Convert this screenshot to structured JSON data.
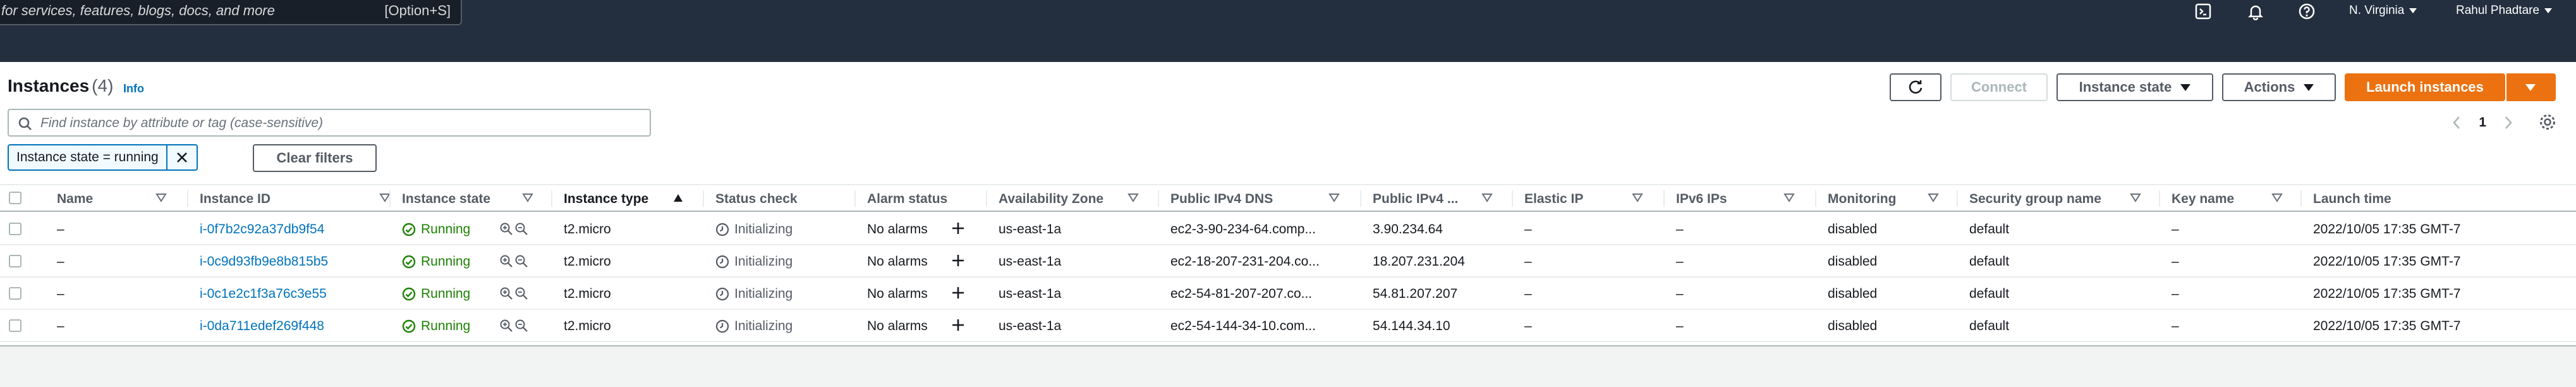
{
  "nav": {
    "search_placeholder": "for services, features, blogs, docs, and more",
    "search_shortcut": "[Option+S]",
    "region": "N. Virginia",
    "user": "Rahul Phadtare"
  },
  "header": {
    "title": "Instances",
    "count": "(4)",
    "info": "Info",
    "connect": "Connect",
    "instance_state": "Instance state",
    "actions": "Actions",
    "launch": "Launch instances"
  },
  "filter": {
    "placeholder": "Find instance by attribute or tag (case-sensitive)",
    "token": "Instance state = running",
    "clear": "Clear filters"
  },
  "pagination": {
    "page": "1"
  },
  "columns": [
    "Name",
    "Instance ID",
    "Instance state",
    "Instance type",
    "Status check",
    "Alarm status",
    "Availability Zone",
    "Public IPv4 DNS",
    "Public IPv4 ...",
    "Elastic IP",
    "IPv6 IPs",
    "Monitoring",
    "Security group name",
    "Key name",
    "Launch time"
  ],
  "rows": [
    {
      "name": "–",
      "id": "i-0f7b2c92a37db9f54",
      "state": "Running",
      "type": "t2.micro",
      "status": "Initializing",
      "alarm": "No alarms",
      "az": "us-east-1a",
      "dns": "ec2-3-90-234-64.comp...",
      "ipv4": "3.90.234.64",
      "eip": "–",
      "ipv6": "–",
      "monitoring": "disabled",
      "sg": "default",
      "key": "–",
      "launch": "2022/10/05 17:35 GMT-7"
    },
    {
      "name": "–",
      "id": "i-0c9d93fb9e8b815b5",
      "state": "Running",
      "type": "t2.micro",
      "status": "Initializing",
      "alarm": "No alarms",
      "az": "us-east-1a",
      "dns": "ec2-18-207-231-204.co...",
      "ipv4": "18.207.231.204",
      "eip": "–",
      "ipv6": "–",
      "monitoring": "disabled",
      "sg": "default",
      "key": "–",
      "launch": "2022/10/05 17:35 GMT-7"
    },
    {
      "name": "–",
      "id": "i-0c1e2c1f3a76c3e55",
      "state": "Running",
      "type": "t2.micro",
      "status": "Initializing",
      "alarm": "No alarms",
      "az": "us-east-1a",
      "dns": "ec2-54-81-207-207.co...",
      "ipv4": "54.81.207.207",
      "eip": "–",
      "ipv6": "–",
      "monitoring": "disabled",
      "sg": "default",
      "key": "–",
      "launch": "2022/10/05 17:35 GMT-7"
    },
    {
      "name": "–",
      "id": "i-0da711edef269f448",
      "state": "Running",
      "type": "t2.micro",
      "status": "Initializing",
      "alarm": "No alarms",
      "az": "us-east-1a",
      "dns": "ec2-54-144-34-10.com...",
      "ipv4": "54.144.34.10",
      "eip": "–",
      "ipv6": "–",
      "monitoring": "disabled",
      "sg": "default",
      "key": "–",
      "launch": "2022/10/05 17:35 GMT-7"
    }
  ],
  "colors": {
    "nav_bg": "#232f3e",
    "primary": "#ec7211",
    "link": "#0073bb",
    "running": "#1d8102"
  },
  "icons": [
    "cloudshell-icon",
    "bell-icon",
    "help-icon",
    "search-icon",
    "refresh-icon",
    "settings-icon",
    "close-icon",
    "zoom-in-icon",
    "zoom-out-icon",
    "check-circle-icon",
    "clock-icon",
    "plus-icon"
  ]
}
